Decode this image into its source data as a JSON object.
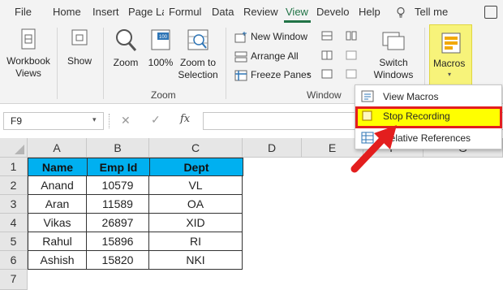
{
  "tabs": [
    {
      "label": "File",
      "active": false
    },
    {
      "label": "Home",
      "active": false
    },
    {
      "label": "Insert",
      "active": false
    },
    {
      "label": "Page La",
      "active": false
    },
    {
      "label": "Formul",
      "active": false
    },
    {
      "label": "Data",
      "active": false
    },
    {
      "label": "Review",
      "active": false
    },
    {
      "label": "View",
      "active": true
    },
    {
      "label": "Develo",
      "active": false
    },
    {
      "label": "Help",
      "active": false
    }
  ],
  "tell_me": "Tell me",
  "ribbon": {
    "workbook_views": "Workbook Views",
    "workbook_views_line1": "Workbook",
    "workbook_views_line2": "Views",
    "show": "Show",
    "zoom": "Zoom",
    "zoom_100": "100%",
    "zoom_to_selection_1": "Zoom to",
    "zoom_to_selection_2": "Selection",
    "zoom_group": "Zoom",
    "new_window": "New Window",
    "arrange_all": "Arrange All",
    "freeze_panes": "Freeze Panes",
    "window_group": "Window",
    "switch_windows_1": "Switch",
    "switch_windows_2": "Windows",
    "macros": "Macros"
  },
  "formula_bar": {
    "name_box": "F9",
    "cancel": "✕",
    "enter": "✓",
    "fx": "fx",
    "value": ""
  },
  "grid": {
    "columns": [
      "A",
      "B",
      "C",
      "D",
      "E",
      "F",
      "G"
    ],
    "rows": [
      "1",
      "2",
      "3",
      "4",
      "5",
      "6",
      "7"
    ],
    "headers": [
      "Name",
      "Emp Id",
      "Dept"
    ],
    "data": [
      [
        "Anand",
        "10579",
        "VL"
      ],
      [
        "Aran",
        "11589",
        "OA"
      ],
      [
        "Vikas",
        "26897",
        "XID"
      ],
      [
        "Rahul",
        "15896",
        "RI"
      ],
      [
        "Ashish",
        "15820",
        "NKI"
      ]
    ]
  },
  "macros_menu": {
    "items": [
      {
        "label": "View Macros",
        "highlighted": false
      },
      {
        "label": "Stop Recording",
        "highlighted": true
      },
      {
        "label": "Relative References",
        "highlighted": false
      }
    ]
  },
  "colors": {
    "accent": "#217346",
    "header_fill": "#00b0f0",
    "highlight": "#ffff00",
    "annotation_red": "#e31e1e"
  }
}
